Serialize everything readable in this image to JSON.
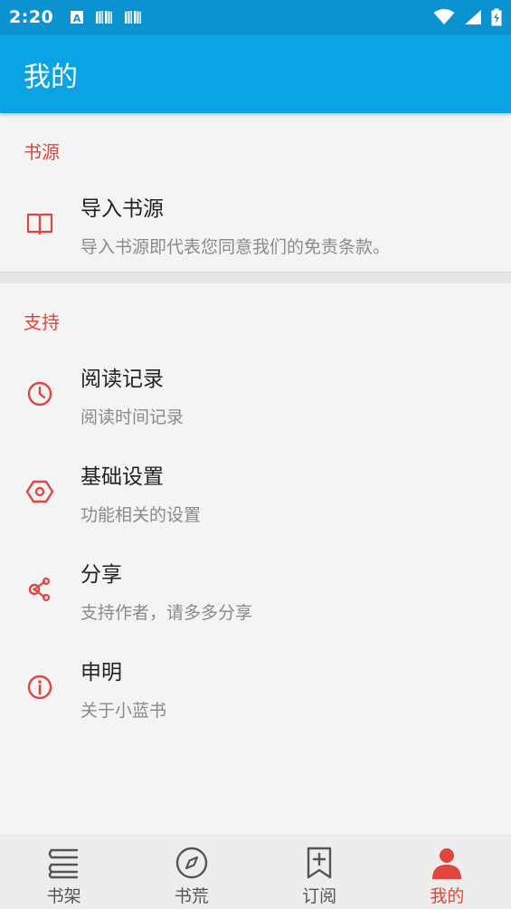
{
  "status_bar": {
    "time": "2:20",
    "left_icons": [
      "a-notification-icon",
      "book-notification-icon",
      "book-notification-icon"
    ],
    "right_icons": [
      "wifi-icon",
      "signal-icon",
      "battery-charging-icon"
    ]
  },
  "app_bar": {
    "title": "我的",
    "color": "#0aa3e3"
  },
  "sections": [
    {
      "header": "书源",
      "items": [
        {
          "title": "导入书源",
          "subtitle": "导入书源即代表您同意我们的免责条款。",
          "icon": "book-open-icon"
        }
      ]
    },
    {
      "header": "支持",
      "items": [
        {
          "title": "阅读记录",
          "subtitle": "阅读时间记录",
          "icon": "clock-icon"
        },
        {
          "title": "基础设置",
          "subtitle": "功能相关的设置",
          "icon": "hexagon-settings-icon"
        },
        {
          "title": "分享",
          "subtitle": "支持作者，请多多分享",
          "icon": "share-icon"
        },
        {
          "title": "申明",
          "subtitle": "关于小蓝书",
          "icon": "info-icon"
        }
      ]
    }
  ],
  "bottom_nav": {
    "items": [
      {
        "label": "书架",
        "icon": "bookshelf-icon",
        "active": false
      },
      {
        "label": "书荒",
        "icon": "compass-icon",
        "active": false
      },
      {
        "label": "订阅",
        "icon": "bookmark-add-icon",
        "active": false
      },
      {
        "label": "我的",
        "icon": "person-icon",
        "active": true
      }
    ]
  },
  "colors": {
    "accent": "#e0463f",
    "primary": "#0aa3e3",
    "status_bar": "#0a93d0"
  }
}
